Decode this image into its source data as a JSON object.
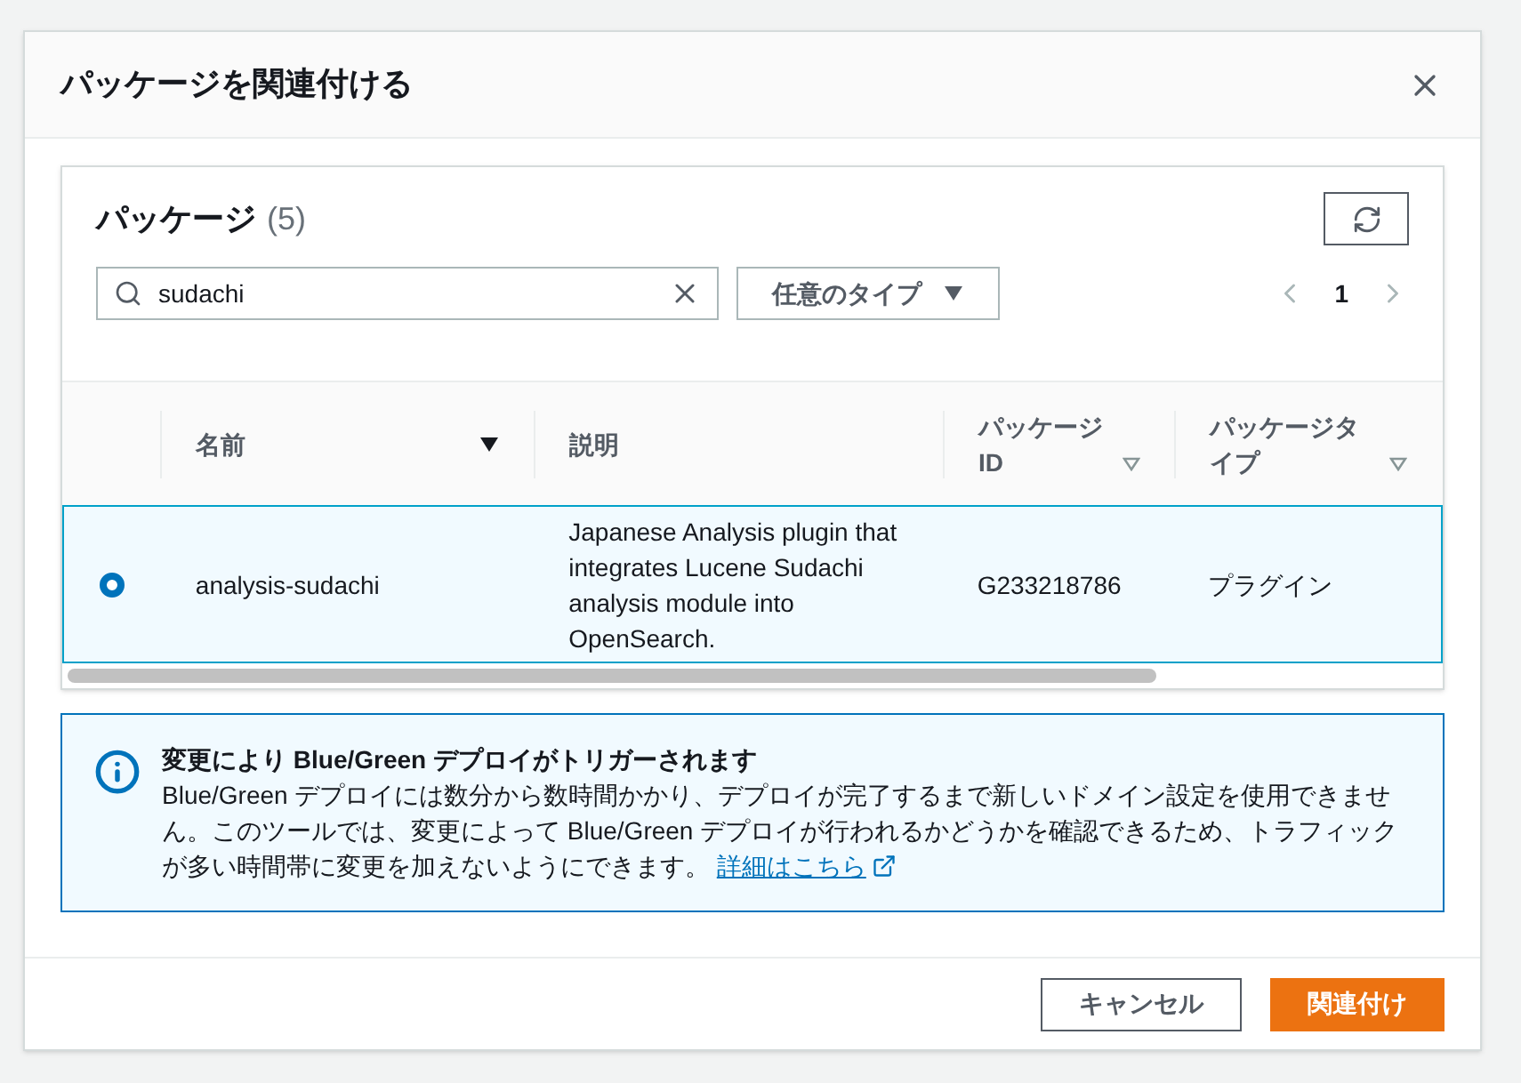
{
  "dialog": {
    "title": "パッケージを関連付ける"
  },
  "packages": {
    "title": "パッケージ",
    "count": "(5)",
    "search": {
      "value": "sudachi"
    },
    "type_filter": "任意のタイプ",
    "page": "1",
    "columns": [
      {
        "label": "名前",
        "sorted": true
      },
      {
        "label": "説明"
      },
      {
        "label": "パッケージ ID",
        "sorted": false
      },
      {
        "label": "パッケージタイプ",
        "sorted": false
      }
    ],
    "rows": [
      {
        "selected": true,
        "cells": [
          "analysis-sudachi",
          "Japanese Analysis plugin that integrates Lucene Sudachi analysis module into OpenSearch.",
          "G233218786",
          "プラグイン"
        ]
      }
    ]
  },
  "alert": {
    "title": "変更により Blue/Green デプロイがトリガーされます",
    "body": "Blue/Green デプロイには数分から数時間かかり、デプロイが完了するまで新しいドメイン設定を使用できません。このツールでは、変更によって Blue/Green デプロイが行われるかどうかを確認できるため、トラフィックが多い時間帯に変更を加えないようにできます。",
    "link": "詳細はこちら"
  },
  "buttons": [
    {
      "label": "キャンセル",
      "kind": "secondary"
    },
    {
      "label": "関連付け",
      "kind": "primary"
    }
  ]
}
